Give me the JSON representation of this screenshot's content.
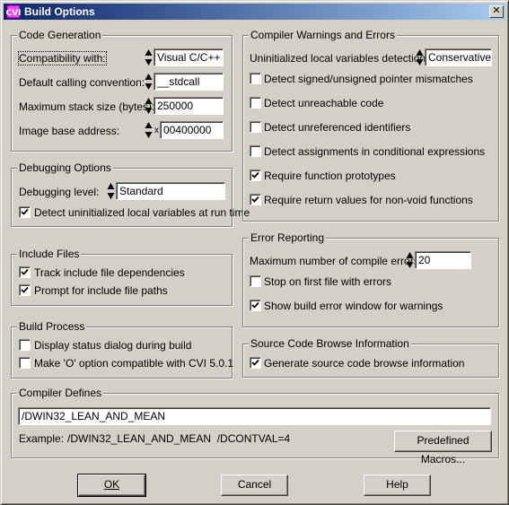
{
  "window": {
    "title": "Build Options",
    "close_label": "✕"
  },
  "code_generation": {
    "title": "Code Generation",
    "compatibility": {
      "label": "Compatibility with:",
      "value": "Visual C/C++"
    },
    "calling_convention": {
      "label": "Default calling convention:",
      "value": "__stdcall"
    },
    "stack_size": {
      "label": "Maximum stack size (bytes):",
      "value": "250000"
    },
    "image_base": {
      "label": "Image base address:",
      "prefix": "x",
      "value": "00400000"
    }
  },
  "debugging": {
    "title": "Debugging Options",
    "level": {
      "label": "Debugging level:",
      "value": "Standard"
    },
    "detect_uninit": {
      "label": "Detect uninitialized local variables at run time",
      "checked": true
    }
  },
  "include_files": {
    "title": "Include Files",
    "track": {
      "label": "Track include file dependencies",
      "checked": true
    },
    "prompt": {
      "label": "Prompt for include file paths",
      "checked": true
    }
  },
  "build_process": {
    "title": "Build Process",
    "status_dialog": {
      "label": "Display status dialog during build",
      "checked": false
    },
    "make_o": {
      "label": "Make 'O' option compatible with CVI 5.0.1",
      "checked": false
    }
  },
  "warnings": {
    "title": "Compiler Warnings and Errors",
    "uninit_detection": {
      "label": "Uninitialized local variables detection:",
      "value": "Conservative"
    },
    "signed_unsigned": {
      "label": "Detect signed/unsigned pointer mismatches",
      "checked": false
    },
    "unreachable": {
      "label": "Detect unreachable code",
      "checked": false
    },
    "unreferenced": {
      "label": "Detect unreferenced identifiers",
      "checked": false
    },
    "assignments": {
      "label": "Detect assignments in conditional expressions",
      "checked": false
    },
    "prototypes": {
      "label": "Require function prototypes",
      "checked": true
    },
    "return_values": {
      "label": "Require return values for non-void functions",
      "checked": true
    }
  },
  "error_reporting": {
    "title": "Error Reporting",
    "max_errors": {
      "label": "Maximum number of compile errors:",
      "value": "20"
    },
    "stop_first": {
      "label": "Stop on first file with errors",
      "checked": false
    },
    "show_window": {
      "label": "Show build error window for warnings",
      "checked": true
    }
  },
  "browse_info": {
    "title": "Source Code Browse Information",
    "generate": {
      "label": "Generate source code browse information",
      "checked": true
    }
  },
  "defines": {
    "title": "Compiler Defines",
    "value": "/DWIN32_LEAN_AND_MEAN",
    "example_label": "Example:",
    "example_value": "/DWIN32_LEAN_AND_MEAN  /DCONTVAL=4",
    "predefined_button": "Predefined Macros..."
  },
  "buttons": {
    "ok": "OK",
    "cancel": "Cancel",
    "help": "Help"
  }
}
